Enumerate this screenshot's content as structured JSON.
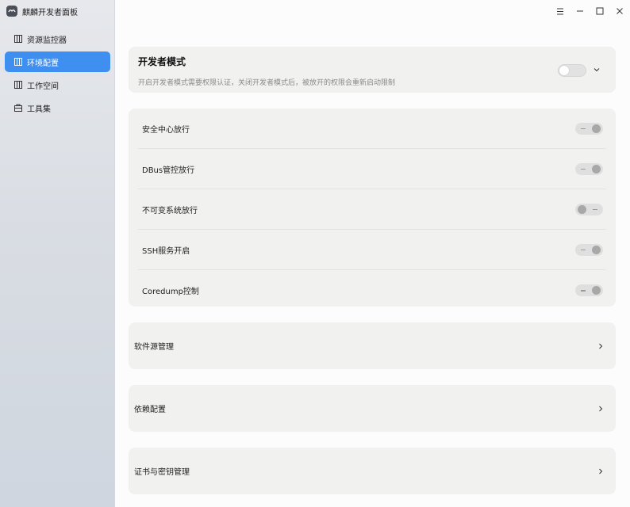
{
  "app": {
    "title": "麒麟开发者面板",
    "logo_icon": "kylin-logo-icon"
  },
  "sidebar": {
    "items": [
      {
        "label": "资源监控器",
        "icon": "monitor-icon",
        "active": false
      },
      {
        "label": "环境配置",
        "icon": "config-icon",
        "active": true
      },
      {
        "label": "工作空间",
        "icon": "workspace-icon",
        "active": false
      },
      {
        "label": "工具集",
        "icon": "toolbox-icon",
        "active": false
      }
    ]
  },
  "window_controls": {
    "menu_icon": "menu-icon",
    "minimize_icon": "minimize-icon",
    "maximize_icon": "maximize-icon",
    "close_icon": "close-icon"
  },
  "developer_mode": {
    "title": "开发者模式",
    "description": "开启开发者模式需要权限认证，关闭开发者模式后，被放开的权限会重新启动限制",
    "enabled": false
  },
  "permissions": [
    {
      "label": "安全中心放行",
      "enabled": true
    },
    {
      "label": "DBus管控放行",
      "enabled": true
    },
    {
      "label": "不可变系统放行",
      "enabled": false
    },
    {
      "label": "SSH服务开启",
      "enabled": true
    },
    {
      "label": "Coredump控制",
      "enabled": true
    }
  ],
  "sections": [
    {
      "label": "软件源管理"
    },
    {
      "label": "依赖配置"
    },
    {
      "label": "证书与密钥管理"
    }
  ],
  "colors": {
    "accent": "#3f8ff0",
    "card": "#f1f1f0"
  }
}
